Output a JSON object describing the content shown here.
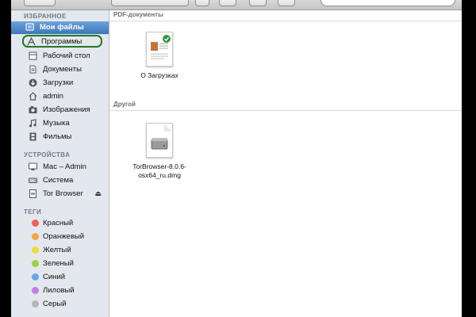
{
  "sidebar": {
    "favorites_header": "ИЗБРАННОЕ",
    "favorites": [
      {
        "label": "Мои файлы",
        "icon": "all-my-files-icon"
      },
      {
        "label": "Программы",
        "icon": "applications-icon"
      },
      {
        "label": "Рабочий стол",
        "icon": "desktop-icon"
      },
      {
        "label": "Документы",
        "icon": "documents-icon"
      },
      {
        "label": "Загрузки",
        "icon": "downloads-icon"
      },
      {
        "label": "admin",
        "icon": "home-icon"
      },
      {
        "label": "Изображения",
        "icon": "pictures-icon"
      },
      {
        "label": "Музыка",
        "icon": "music-icon"
      },
      {
        "label": "Фильмы",
        "icon": "movies-icon"
      }
    ],
    "devices_header": "УСТРОЙСТВА",
    "devices": [
      {
        "label": "Mac – Admin",
        "icon": "computer-icon"
      },
      {
        "label": "Система",
        "icon": "hard-drive-icon"
      },
      {
        "label": "Tor Browser",
        "icon": "disk-image-icon",
        "eject": "⏏"
      }
    ],
    "tags_header": "ТЕГИ",
    "tags": [
      {
        "label": "Красный",
        "color": "#f0605a"
      },
      {
        "label": "Оранжевый",
        "color": "#f6a440"
      },
      {
        "label": "Желтый",
        "color": "#f2d93a"
      },
      {
        "label": "Зеленый",
        "color": "#9ed23d"
      },
      {
        "label": "Синий",
        "color": "#62a9e8"
      },
      {
        "label": "Лиловый",
        "color": "#c77be0"
      },
      {
        "label": "Серый",
        "color": "#b5b5b5"
      }
    ]
  },
  "content": {
    "groups": [
      {
        "title": "PDF-документы",
        "files": [
          {
            "name": "О Загрузках",
            "icon": "pdf-document-icon"
          }
        ]
      },
      {
        "title": "Другой",
        "files": [
          {
            "name": "TorBrowser-8.0.6-osx64_ru.dmg",
            "name_line1": "TorBrowser-8.0.6-",
            "name_line2": "osx64_ru.dmg",
            "icon": "dmg-file-icon"
          }
        ]
      }
    ]
  },
  "colors": {
    "selection": "#3b77bd",
    "highlight_ring": "#1f7a1f",
    "sidebar_bg": "#e3e8ee"
  }
}
